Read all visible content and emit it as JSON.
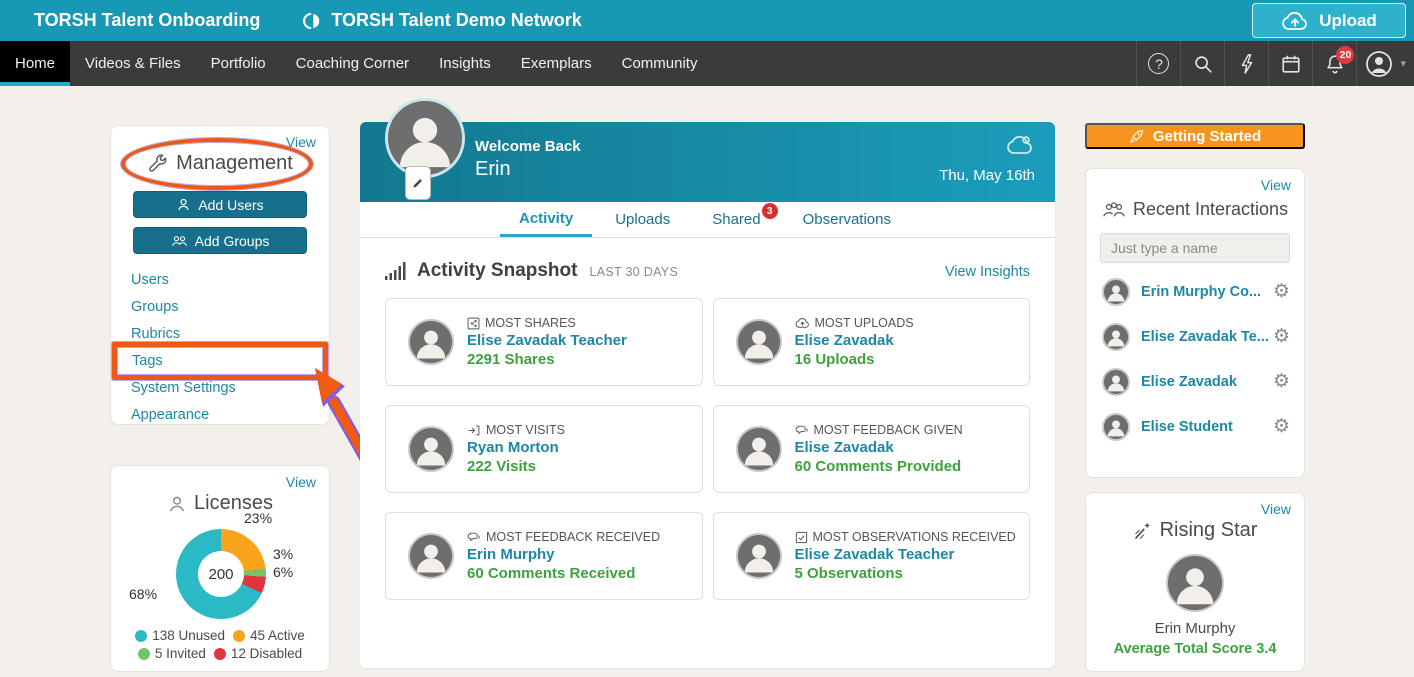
{
  "topbar": {
    "app_title": "TORSH Talent Onboarding",
    "network_name": "TORSH Talent Demo Network",
    "upload_label": "Upload"
  },
  "navbar": {
    "items": [
      "Home",
      "Videos & Files",
      "Portfolio",
      "Coaching Corner",
      "Insights",
      "Exemplars",
      "Community"
    ],
    "active_item": "Home",
    "notification_count": "20"
  },
  "icons": {
    "help_glyph": "?",
    "gear_glyph": "⚙",
    "caret_glyph": "▾",
    "names": [
      "logo-mark-icon",
      "upload-cloud-icon",
      "help-icon",
      "search-icon",
      "bolt-icon",
      "calendar-icon",
      "bell-icon",
      "avatar-icon",
      "caret-down-icon",
      "wrench-icon",
      "add-user-icon",
      "add-group-icon",
      "user-icon",
      "bar-chart-icon",
      "share-icon",
      "cloud-upload-icon",
      "visits-arrow-icon",
      "chat-icon",
      "checkbox-icon",
      "rocket-icon",
      "people-icon",
      "gear-icon",
      "pencil-icon",
      "weather-cloud-icon",
      "shooting-star-icon"
    ]
  },
  "management": {
    "view_label": "View",
    "title": "Management",
    "add_users_label": "Add Users",
    "add_groups_label": "Add Groups",
    "links": [
      "Users",
      "Groups",
      "Rubrics",
      "Tags",
      "System Settings",
      "Appearance"
    ],
    "highlighted_link": "Tags"
  },
  "licenses": {
    "view_label": "View",
    "title": "Licenses"
  },
  "chart_data": {
    "type": "pie",
    "title": "Licenses",
    "total_label": "200",
    "order_clockwise_from_top": [
      "Active",
      "Invited",
      "Disabled",
      "Unused"
    ],
    "segments": {
      "Unused": {
        "count": 138,
        "value": 68,
        "percent_label": "68%",
        "legend_label": "138 Unused",
        "color": "#2bbac5"
      },
      "Active": {
        "count": 45,
        "value": 23,
        "percent_label": "23%",
        "legend_label": "45 Active",
        "color": "#faa41e"
      },
      "Invited": {
        "count": 5,
        "value": 3,
        "percent_label": "3%",
        "legend_label": "5 Invited",
        "color": "#74c365"
      },
      "Disabled": {
        "count": 12,
        "value": 6,
        "percent_label": "6%",
        "legend_label": "12 Disabled",
        "color": "#e0343f"
      }
    },
    "legend_order": [
      "Unused",
      "Active",
      "Invited",
      "Disabled"
    ]
  },
  "welcome": {
    "greeting": "Welcome Back",
    "name": "Erin",
    "date": "Thu, May 16th"
  },
  "tabs": [
    {
      "label": "Activity",
      "active": true
    },
    {
      "label": "Uploads"
    },
    {
      "label": "Shared",
      "badge": "3"
    },
    {
      "label": "Observations"
    }
  ],
  "snapshot": {
    "title": "Activity Snapshot",
    "subtitle": "LAST 30 DAYS",
    "view_insights_label": "View Insights",
    "cards": [
      {
        "label": "MOST SHARES",
        "name": "Elise Zavadak Teacher",
        "value": "2291 Shares"
      },
      {
        "label": "MOST UPLOADS",
        "name": "Elise Zavadak",
        "value": "16 Uploads"
      },
      {
        "label": "MOST VISITS",
        "name": "Ryan Morton",
        "value": "222 Visits"
      },
      {
        "label": "MOST FEEDBACK GIVEN",
        "name": "Elise Zavadak",
        "value": "60 Comments Provided"
      },
      {
        "label": "MOST FEEDBACK RECEIVED",
        "name": "Erin Murphy",
        "value": "60 Comments Received"
      },
      {
        "label": "MOST OBSERVATIONS RECEIVED",
        "name": "Elise Zavadak Teacher",
        "value": "5 Observations"
      }
    ]
  },
  "getting_started": {
    "label": "Getting Started"
  },
  "recent_interactions": {
    "view_label": "View",
    "title": "Recent Interactions",
    "search_placeholder": "Just type a name",
    "people": [
      {
        "name": "Erin Murphy Co..."
      },
      {
        "name": "Elise Zavadak Te..."
      },
      {
        "name": "Elise Zavadak"
      },
      {
        "name": "Elise Student"
      }
    ]
  },
  "rising_star": {
    "view_label": "View",
    "title": "Rising Star",
    "name": "Erin Murphy",
    "score_label": "Average Total Score 3.4"
  },
  "colors": {
    "topbar_teal": "#1798b5",
    "nav_dark": "#3b3b3b",
    "accent_teal_link": "#1d87a5",
    "button_teal": "#17708b",
    "highlight_orange": "#ee5a13",
    "getting_started_orange": "#f7941e",
    "value_green": "#3da23d",
    "badge_red": "#e03a3a"
  }
}
